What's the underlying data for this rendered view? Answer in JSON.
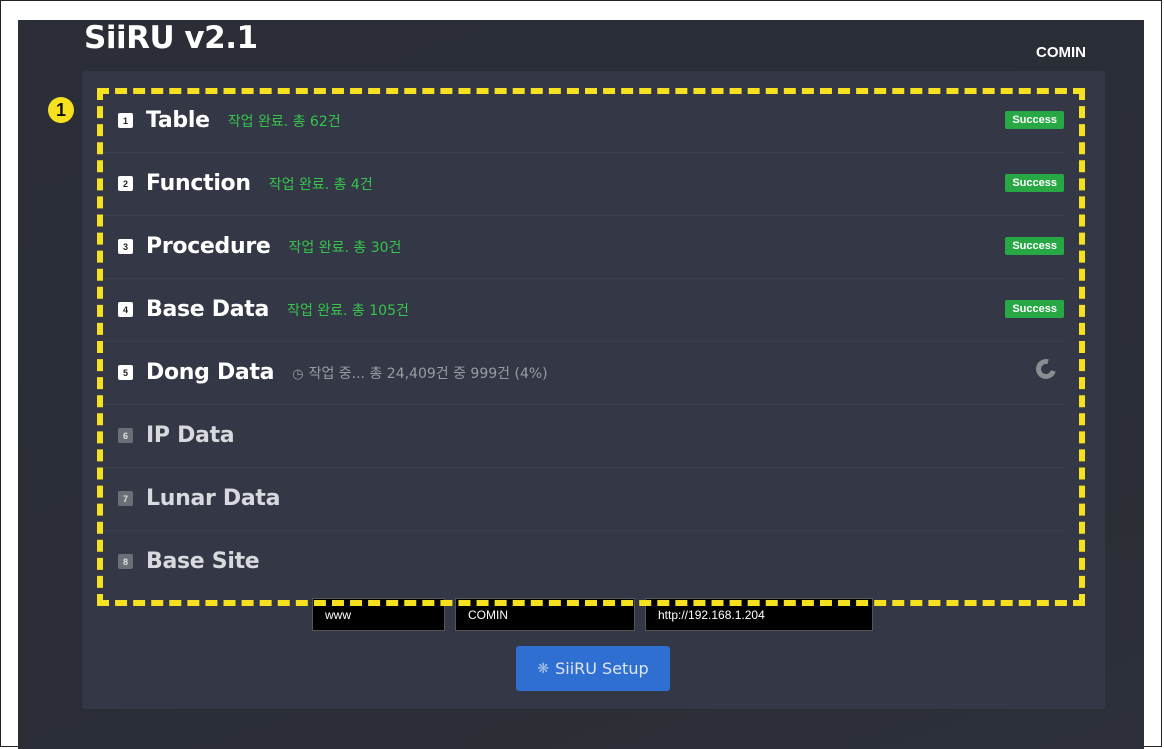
{
  "app": {
    "title": "SiiRU v2.1",
    "user": "COMIN"
  },
  "annotation": {
    "marker": "1"
  },
  "steps": [
    {
      "num": "1",
      "name": "Table",
      "status": "작업 완료. 총 62건",
      "badge": "Success",
      "state": "success"
    },
    {
      "num": "2",
      "name": "Function",
      "status": "작업 완료. 총 4건",
      "badge": "Success",
      "state": "success"
    },
    {
      "num": "3",
      "name": "Procedure",
      "status": "작업 완료. 총 30건",
      "badge": "Success",
      "state": "success"
    },
    {
      "num": "4",
      "name": "Base Data",
      "status": "작업 완료. 총 105건",
      "badge": "Success",
      "state": "success"
    },
    {
      "num": "5",
      "name": "Dong Data",
      "status": "작업 중... 총 24,409건 중 999건 (4%)",
      "state": "running",
      "progress": 0.04
    },
    {
      "num": "6",
      "name": "IP Data",
      "state": "pending"
    },
    {
      "num": "7",
      "name": "Lunar Data",
      "state": "pending"
    },
    {
      "num": "8",
      "name": "Base Site",
      "state": "pending"
    }
  ],
  "fields": {
    "site": "www",
    "company": "COMIN",
    "server": "http://192.168.1.204"
  },
  "setup_button": {
    "label": "SiiRU Setup",
    "icon": "gear-icon"
  },
  "colors": {
    "success": "#28a745",
    "highlight": "#f5e120",
    "button": "#2f6fd1"
  }
}
